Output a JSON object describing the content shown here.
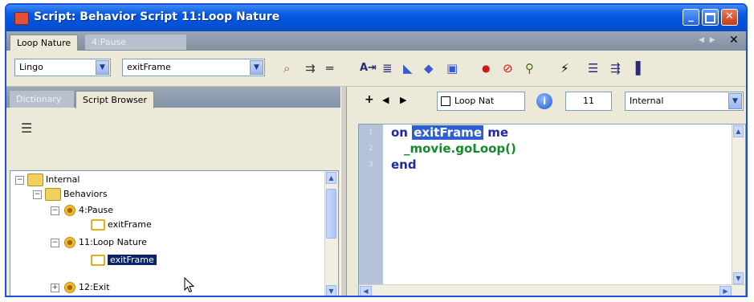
{
  "window": {
    "title": "Script: Behavior Script 11:Loop Nature"
  },
  "tabs": [
    {
      "label": "Loop Nature",
      "active": true
    },
    {
      "label": "4:Pause",
      "active": false
    }
  ],
  "toolbar": {
    "language_select": {
      "value": "Lingo"
    },
    "handler_select": {
      "value": "exitFrame"
    }
  },
  "left_pane": {
    "tabs": [
      {
        "label": "Dictionary",
        "active": false
      },
      {
        "label": "Script Browser",
        "active": true
      }
    ],
    "tree": {
      "nodes": [
        {
          "label": "Internal"
        },
        {
          "label": "Behaviors"
        },
        {
          "label": "4:Pause"
        },
        {
          "label": "exitFrame"
        },
        {
          "label": "11:Loop Nature"
        },
        {
          "label": "exitFrame",
          "selected": true
        },
        {
          "label": "12:Exit"
        }
      ]
    }
  },
  "right_pane": {
    "member_field": "Loop Nat",
    "number_field": "11",
    "cast_select": "Internal",
    "line_numbers": [
      "1",
      "2",
      "3"
    ],
    "code": {
      "line1_keyword": "on",
      "line1_selected": "exitFrame",
      "line1_end": "me",
      "line2": "_movie.goLoop()",
      "line3": "end"
    }
  },
  "colors": {
    "title_bar": "#0052d9",
    "selection": "#0a246a",
    "code_keyword": "#1f2a9e",
    "code_call": "#138a2a"
  }
}
